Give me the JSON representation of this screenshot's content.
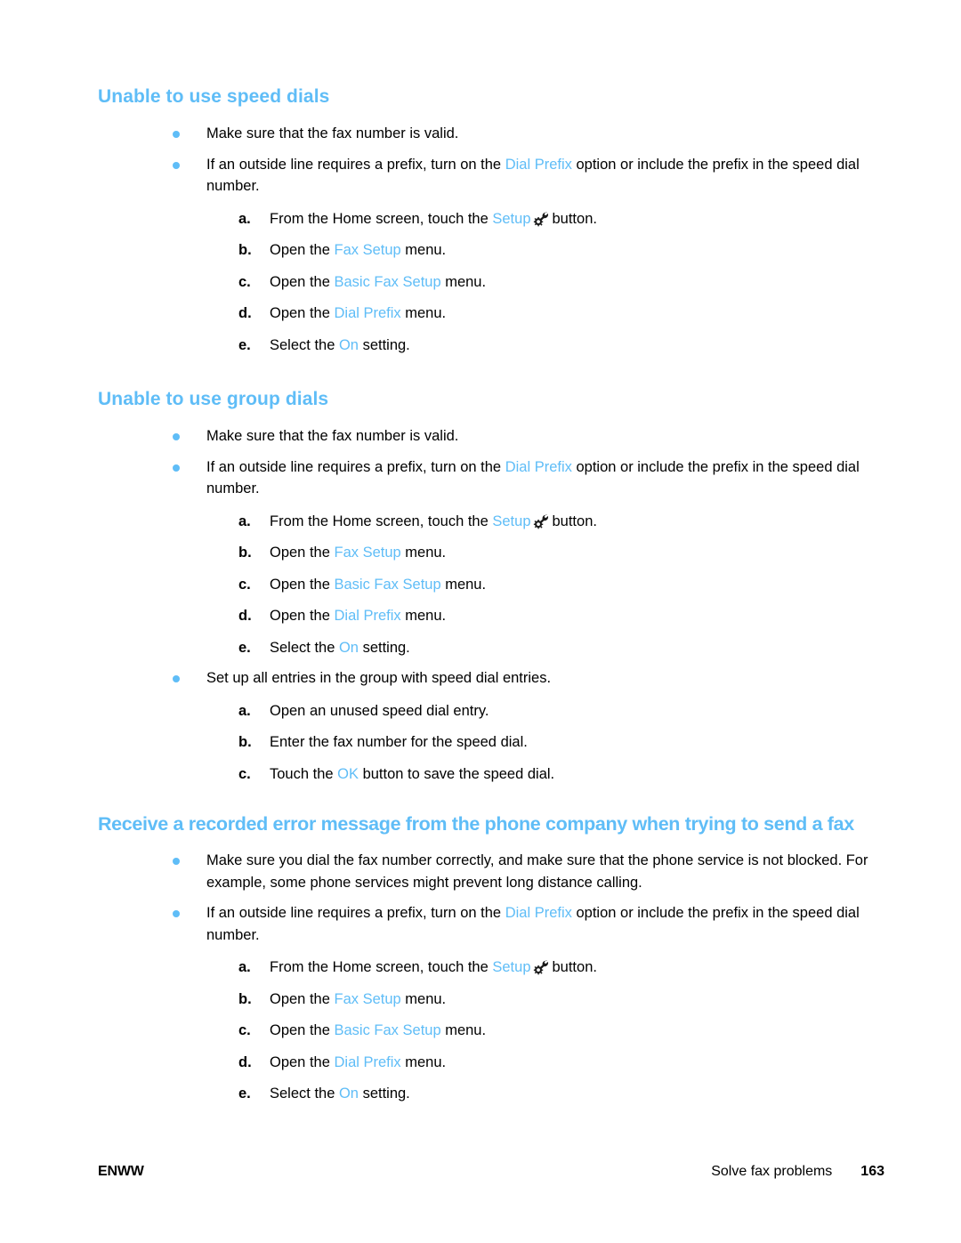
{
  "document": {
    "footer": {
      "left_label": "ENWW",
      "chapter_label": "Solve fax problems",
      "page_number": "163"
    }
  },
  "icons": {
    "setup_icon_name": "setup-wrench-gear-icon"
  },
  "colors": {
    "accent_blue": "#5FBDF7",
    "body_text": "#000000",
    "page_background": "#FFFFFF"
  },
  "sections": [
    {
      "heading": "Unable to use speed dials",
      "bullets": [
        {
          "parts": [
            {
              "t": "text",
              "v": "Make sure that the fax number is valid."
            }
          ],
          "substeps": []
        },
        {
          "parts": [
            {
              "t": "text",
              "v": "If an outside line requires a prefix, turn on the "
            },
            {
              "t": "ui",
              "v": "Dial Prefix"
            },
            {
              "t": "text",
              "v": " option or include the prefix in the speed dial number."
            }
          ],
          "substeps": [
            {
              "marker": "a.",
              "parts": [
                {
                  "t": "text",
                  "v": "From the Home screen, touch the "
                },
                {
                  "t": "ui",
                  "v": "Setup"
                },
                {
                  "t": "icon",
                  "v": "setup"
                },
                {
                  "t": "text",
                  "v": "button."
                }
              ]
            },
            {
              "marker": "b.",
              "parts": [
                {
                  "t": "text",
                  "v": "Open the "
                },
                {
                  "t": "ui",
                  "v": "Fax Setup"
                },
                {
                  "t": "text",
                  "v": " menu."
                }
              ]
            },
            {
              "marker": "c.",
              "parts": [
                {
                  "t": "text",
                  "v": "Open the "
                },
                {
                  "t": "ui",
                  "v": "Basic Fax Setup"
                },
                {
                  "t": "text",
                  "v": " menu."
                }
              ]
            },
            {
              "marker": "d.",
              "parts": [
                {
                  "t": "text",
                  "v": "Open the "
                },
                {
                  "t": "ui",
                  "v": "Dial Prefix"
                },
                {
                  "t": "text",
                  "v": " menu."
                }
              ]
            },
            {
              "marker": "e.",
              "parts": [
                {
                  "t": "text",
                  "v": "Select the "
                },
                {
                  "t": "ui",
                  "v": "On"
                },
                {
                  "t": "text",
                  "v": " setting."
                }
              ]
            }
          ]
        }
      ]
    },
    {
      "heading": "Unable to use group dials",
      "bullets": [
        {
          "parts": [
            {
              "t": "text",
              "v": "Make sure that the fax number is valid."
            }
          ],
          "substeps": []
        },
        {
          "parts": [
            {
              "t": "text",
              "v": "If an outside line requires a prefix, turn on the "
            },
            {
              "t": "ui",
              "v": "Dial Prefix"
            },
            {
              "t": "text",
              "v": " option or include the prefix in the speed dial number."
            }
          ],
          "substeps": [
            {
              "marker": "a.",
              "parts": [
                {
                  "t": "text",
                  "v": "From the Home screen, touch the "
                },
                {
                  "t": "ui",
                  "v": "Setup"
                },
                {
                  "t": "icon",
                  "v": "setup"
                },
                {
                  "t": "text",
                  "v": "button."
                }
              ]
            },
            {
              "marker": "b.",
              "parts": [
                {
                  "t": "text",
                  "v": "Open the "
                },
                {
                  "t": "ui",
                  "v": "Fax Setup"
                },
                {
                  "t": "text",
                  "v": " menu."
                }
              ]
            },
            {
              "marker": "c.",
              "parts": [
                {
                  "t": "text",
                  "v": "Open the "
                },
                {
                  "t": "ui",
                  "v": "Basic Fax Setup"
                },
                {
                  "t": "text",
                  "v": " menu."
                }
              ]
            },
            {
              "marker": "d.",
              "parts": [
                {
                  "t": "text",
                  "v": "Open the "
                },
                {
                  "t": "ui",
                  "v": "Dial Prefix"
                },
                {
                  "t": "text",
                  "v": " menu."
                }
              ]
            },
            {
              "marker": "e.",
              "parts": [
                {
                  "t": "text",
                  "v": "Select the "
                },
                {
                  "t": "ui",
                  "v": "On"
                },
                {
                  "t": "text",
                  "v": " setting."
                }
              ]
            }
          ]
        },
        {
          "parts": [
            {
              "t": "text",
              "v": "Set up all entries in the group with speed dial entries."
            }
          ],
          "substeps": [
            {
              "marker": "a.",
              "parts": [
                {
                  "t": "text",
                  "v": "Open an unused speed dial entry."
                }
              ]
            },
            {
              "marker": "b.",
              "parts": [
                {
                  "t": "text",
                  "v": "Enter the fax number for the speed dial."
                }
              ]
            },
            {
              "marker": "c.",
              "parts": [
                {
                  "t": "text",
                  "v": "Touch the "
                },
                {
                  "t": "ui",
                  "v": "OK"
                },
                {
                  "t": "text",
                  "v": " button to save the speed dial."
                }
              ]
            }
          ]
        }
      ]
    },
    {
      "heading": "Receive a recorded error message from the phone company when trying to send a fax",
      "wide": true,
      "bullets": [
        {
          "parts": [
            {
              "t": "text",
              "v": "Make sure you dial the fax number correctly, and make sure that the phone service is not blocked. For example, some phone services might prevent long distance calling."
            }
          ],
          "substeps": []
        },
        {
          "parts": [
            {
              "t": "text",
              "v": "If an outside line requires a prefix, turn on the "
            },
            {
              "t": "ui",
              "v": "Dial Prefix"
            },
            {
              "t": "text",
              "v": " option or include the prefix in the speed dial number."
            }
          ],
          "substeps": [
            {
              "marker": "a.",
              "parts": [
                {
                  "t": "text",
                  "v": "From the Home screen, touch the "
                },
                {
                  "t": "ui",
                  "v": "Setup"
                },
                {
                  "t": "icon",
                  "v": "setup"
                },
                {
                  "t": "text",
                  "v": "button."
                }
              ]
            },
            {
              "marker": "b.",
              "parts": [
                {
                  "t": "text",
                  "v": "Open the "
                },
                {
                  "t": "ui",
                  "v": "Fax Setup"
                },
                {
                  "t": "text",
                  "v": " menu."
                }
              ]
            },
            {
              "marker": "c.",
              "parts": [
                {
                  "t": "text",
                  "v": "Open the "
                },
                {
                  "t": "ui",
                  "v": "Basic Fax Setup"
                },
                {
                  "t": "text",
                  "v": " menu."
                }
              ]
            },
            {
              "marker": "d.",
              "parts": [
                {
                  "t": "text",
                  "v": "Open the "
                },
                {
                  "t": "ui",
                  "v": "Dial Prefix"
                },
                {
                  "t": "text",
                  "v": " menu."
                }
              ]
            },
            {
              "marker": "e.",
              "parts": [
                {
                  "t": "text",
                  "v": "Select the "
                },
                {
                  "t": "ui",
                  "v": "On"
                },
                {
                  "t": "text",
                  "v": " setting."
                }
              ]
            }
          ]
        }
      ]
    }
  ]
}
